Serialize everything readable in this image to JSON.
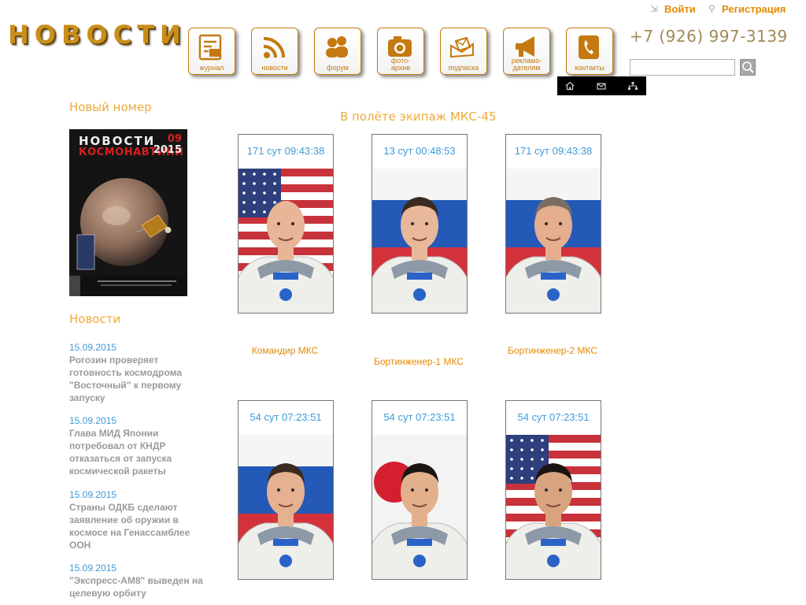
{
  "header": {
    "logo_text": "НОВОСТИ",
    "phone": "+7 (926) 997-3139",
    "login_label": "Войти",
    "register_label": "Регистрация",
    "search_placeholder": ""
  },
  "nav": [
    {
      "label": "журнал",
      "icon": "magazine-icon"
    },
    {
      "label": "новости",
      "icon": "rss-icon"
    },
    {
      "label": "форум",
      "icon": "users-icon"
    },
    {
      "label": "фото-\nархив",
      "icon": "camera-icon"
    },
    {
      "label": "подписка",
      "icon": "envelopes-icon"
    },
    {
      "label": "рекламо-\nдателям",
      "icon": "megaphone-icon"
    },
    {
      "label": "контакты",
      "icon": "phone-icon"
    }
  ],
  "quickbar": [
    "home-icon",
    "mail-icon",
    "sitemap-icon"
  ],
  "sidebar": {
    "new_issue_title": "Новый номер",
    "cover": {
      "title1": "НОВОСТИ",
      "title2": "КОСМОНАВТИКИ",
      "issue": "09",
      "year": "2015"
    },
    "news_title": "Новости",
    "news": [
      {
        "date": "15.09.2015",
        "text": "Рогозин проверяет готовность космодрома \"Восточный\" к первому запуску"
      },
      {
        "date": "15.09.2015",
        "text": "Глава МИД Японии потребовал от КНДР отказаться от запуска космической ракеты"
      },
      {
        "date": "15.09.2015",
        "text": "Страны ОДКБ сделают заявление об оружии в космосе на Генассамблее ООН"
      },
      {
        "date": "15.09.2015",
        "text": "\"Экспресс-АМ8\" выведен на целевую орбиту"
      }
    ]
  },
  "main": {
    "title": "В полёте экипаж МКС-45",
    "crew": [
      {
        "timer": "171 сут 09:43:38",
        "role": "Командир МКС",
        "flag": "usa",
        "hair": "bald",
        "skin": "#e8b596"
      },
      {
        "timer": "13 сут 00:48:53",
        "role": "Бортинженер-1 МКС",
        "flag": "russia",
        "hair": "dark",
        "skin": "#e9b89a"
      },
      {
        "timer": "171 сут 09:43:38",
        "role": "Бортинженер-2 МКС",
        "flag": "russia",
        "hair": "grey",
        "skin": "#e4ae8f"
      },
      {
        "timer": "54 сут 07:23:51",
        "role": "",
        "flag": "russia",
        "hair": "dark",
        "skin": "#e6b190"
      },
      {
        "timer": "54 сут 07:23:51",
        "role": "",
        "flag": "japan",
        "hair": "black",
        "skin": "#e3b08c"
      },
      {
        "timer": "54 сут 07:23:51",
        "role": "",
        "flag": "usa",
        "hair": "black",
        "skin": "#d9a37f"
      }
    ]
  },
  "colors": {
    "accent": "#ecab3a",
    "link": "#3f9ad8",
    "nav_border": "#c47a10"
  }
}
